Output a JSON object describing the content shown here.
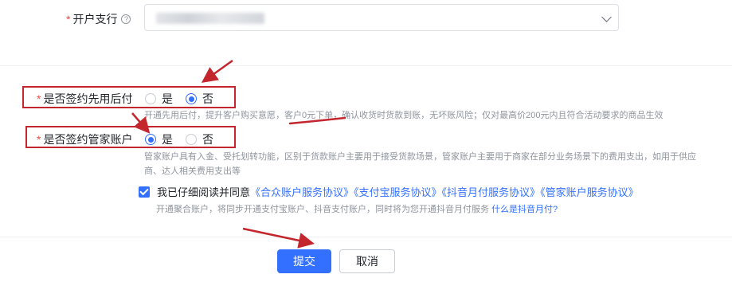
{
  "branch": {
    "required_mark": "*",
    "label": "开户支行",
    "help_icon": "question-circle-icon"
  },
  "pay_later": {
    "required_mark": "*",
    "label": "是否签约先用后付",
    "options": [
      "是",
      "否"
    ],
    "selected": "否",
    "hint": "开通先用后付，提升客户购买意愿，客户0元下单，确认收货时货款到账，无坏账风险；仅对最高价200元内且符合活动要求的商品生效"
  },
  "steward": {
    "required_mark": "*",
    "label": "是否签约管家账户",
    "options": [
      "是",
      "否"
    ],
    "selected": "是",
    "hint_line1": "管家账户具有入金、受托划转功能，区别于货款账户主要用于接受货款场景，管家账户主要用于商家在部分业务场景下的费用支出，如用于供应",
    "hint_line2": "商、达人相关费用支出等"
  },
  "agreement": {
    "checked": true,
    "prefix": "我已仔细阅读并同意",
    "links": [
      "《合众账户服务协议》",
      "《支付宝服务协议》",
      "《抖音月付服务协议》",
      "《管家账户服务协议》"
    ],
    "note": "开通聚合账户，将同步开通支付宝账户、抖音支付账户，同时将为您开通抖音月付服务",
    "note_link": "什么是抖音月付?"
  },
  "actions": {
    "submit_label": "提交",
    "cancel_label": "取消"
  },
  "colors": {
    "primary": "#3370ff",
    "annotation_red": "#c4262e",
    "required_red": "#f54a45"
  }
}
